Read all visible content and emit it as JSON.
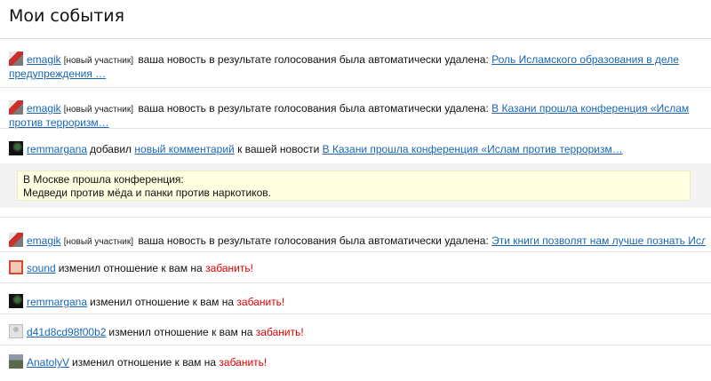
{
  "page": {
    "title": "Мои события"
  },
  "events": [
    {
      "user": "emagik",
      "tag": "[новый участник]",
      "text": "ваша новость в результате голосования была автоматически удалена:",
      "link": "Роль Исламского образования в деле предупреждения …"
    },
    {
      "user": "emagik",
      "tag": "[новый участник]",
      "text": "ваша новость в результате голосования была автоматически удалена:",
      "link": "В Казани прошла конференция «Ислам против терроризм…"
    },
    {
      "user": "remmargana",
      "text_before": "добавил",
      "comment_link": "новый комментарий",
      "text_after": "к вашей новости",
      "link": "В Казани прошла конференция «Ислам против терроризм…",
      "quote_line1": "В Москве прошла конференция:",
      "quote_line2": "Медведи против мёда и панки против наркотиков."
    },
    {
      "user": "emagik",
      "tag": "[новый участник]",
      "text": "ваша новость в результате голосования была автоматически удалена:",
      "link": "Эти книги позволят нам лучше познать Ислам."
    },
    {
      "user": "sound",
      "text": "изменил отношение к вам на",
      "status": "забанить!"
    },
    {
      "user": "remmargana",
      "text": "изменил отношение к вам на",
      "status": "забанить!"
    },
    {
      "user": "d41d8cd98f00b2",
      "text": "изменил отношение к вам на",
      "status": "забанить!"
    },
    {
      "user": "AnatolyV",
      "text": "изменил отношение к вам на",
      "status": "забанить!"
    }
  ],
  "avatars": [
    "emagik-avatar",
    "remmargana-avatar",
    "sound-avatar",
    "d41-avatar",
    "anatolyv-avatar"
  ],
  "colors": {
    "link": "#1a66b4",
    "ban": "#e00000",
    "quote_bg": "#ffffe1"
  }
}
